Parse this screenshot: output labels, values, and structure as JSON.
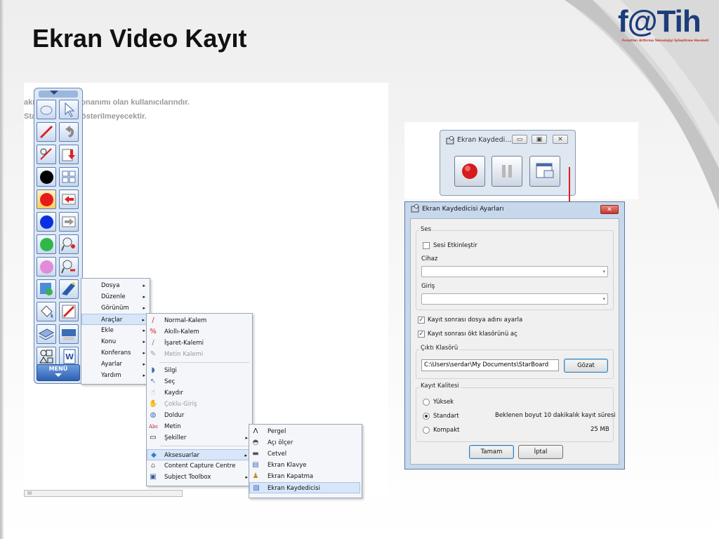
{
  "slide": {
    "title": "Ekran Video Kayıt",
    "logo_text": "f@Tih",
    "logo_subtitle": "Fırsatları Arttırma Teknolojiyi İyileştirme Hareketi"
  },
  "background_page": {
    "line1": "akı         StarBoard donanımı olan kullanıcılarındır.",
    "line2": "Sta         andığında gösterilmeyecektir.",
    "scrollbar_text": "III"
  },
  "toolbar": {
    "menu_label": "MENÜ",
    "buttons": [
      "mouse-icon",
      "select-icon",
      "pen-icon",
      "undo-icon",
      "pen-eraser-icon",
      "import-icon",
      "black-color",
      "grid-icon",
      "red-color",
      "back-icon",
      "blue-color",
      "forward-icon",
      "green-color",
      "zoom-in-icon",
      "pink-color",
      "zoom-out-icon",
      "capture-icon",
      "tools-icon",
      "fill-icon",
      "draw-icon",
      "stack-icon",
      "keyboard-icon",
      "shapes-icon",
      "word-icon"
    ]
  },
  "main_menu": {
    "items": [
      {
        "label": "Dosya",
        "arrow": "▸"
      },
      {
        "label": "Düzenle",
        "arrow": "▸"
      },
      {
        "label": "Görünüm",
        "arrow": "▸"
      },
      {
        "label": "Araçlar",
        "arrow": "▸"
      },
      {
        "label": "Ekle",
        "arrow": "▸"
      },
      {
        "label": "Konu",
        "arrow": "▸"
      },
      {
        "label": "Konferans",
        "arrow": "▸"
      },
      {
        "label": "Ayarlar",
        "arrow": "▸"
      },
      {
        "label": "Yardım",
        "arrow": "▸"
      }
    ]
  },
  "tools_menu": {
    "items": [
      {
        "label": "Normal-Kalem",
        "icon": "/"
      },
      {
        "label": "Akıllı-Kalem",
        "icon": "%"
      },
      {
        "label": "İşaret-Kalemi",
        "icon": "/"
      },
      {
        "label": "Metin Kalemi",
        "icon": "✎"
      },
      {
        "label": "Silgi",
        "icon": "◗"
      },
      {
        "label": "Seç",
        "icon": "↖"
      },
      {
        "label": "Kaydır",
        "icon": "☝"
      },
      {
        "label": "Çoklu-Giriş",
        "icon": "✋"
      },
      {
        "label": "Doldur",
        "icon": "◍"
      },
      {
        "label": "Metin",
        "icon": "Abc"
      },
      {
        "label": "Şekiller",
        "icon": "▭"
      },
      {
        "label": "Aksesuarlar",
        "icon": "◆"
      },
      {
        "label": "Content Capture Centre",
        "icon": "⌂"
      },
      {
        "label": "Subject Toolbox",
        "icon": "▣"
      }
    ]
  },
  "accessories_menu": {
    "items": [
      {
        "label": "Pergel",
        "icon": "Λ"
      },
      {
        "label": "Açı ölçer",
        "icon": "◓"
      },
      {
        "label": "Cetvel",
        "icon": "▬"
      },
      {
        "label": "Ekran Klavye",
        "icon": "▤"
      },
      {
        "label": "Ekran Kapatma",
        "icon": "♟"
      },
      {
        "label": "Ekran Kaydedicisi",
        "icon": "▧"
      }
    ]
  },
  "recorder": {
    "title": "Ekran Kaydedi...",
    "minimize": "▭",
    "maximize": "▣",
    "close": "✕"
  },
  "settings": {
    "title": "Ekran Kaydedicisi Ayarları",
    "close": "✕",
    "ses_group": "Ses",
    "enable_audio": "Sesi Etkinleştir",
    "device_label": "Cihaz",
    "input_label": "Giriş",
    "adjust_filename": "Kayıt sonrası dosya adını ayarla",
    "open_folder": "Kayıt sonrası ökt klasörünü aç",
    "output_group": "Çıktı Klasörü",
    "output_path": "C:\\Users\\serdar\\My Documents\\StarBoard",
    "browse": "Gözat",
    "quality_group": "Kayıt Kalitesi",
    "quality_high": "Yüksek",
    "quality_standard": "Standart",
    "quality_compact": "Kompakt",
    "expected_size": "Beklenen boyut 10 dakikalık kayıt süresi",
    "size_value": "25 MB",
    "ok": "Tamam",
    "cancel": "İptal"
  },
  "colors": {
    "accent": "#1d3c7a",
    "arrow": "#e02020",
    "record": "#d51b1b"
  }
}
